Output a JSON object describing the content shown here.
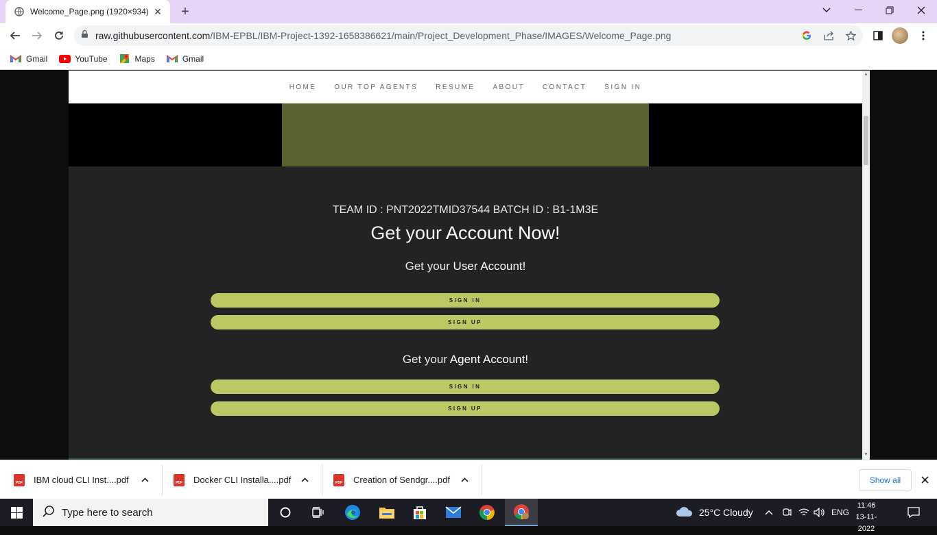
{
  "browser": {
    "tab_title": "Welcome_Page.png (1920×934)",
    "url_domain": "raw.githubusercontent.com",
    "url_path": "/IBM-EPBL/IBM-Project-1392-1658386621/main/Project_Development_Phase/IMAGES/Welcome_Page.png",
    "bookmarks": [
      {
        "label": "Gmail",
        "icon": "gmail-icon"
      },
      {
        "label": "YouTube",
        "icon": "youtube-icon"
      },
      {
        "label": "Maps",
        "icon": "maps-icon"
      },
      {
        "label": "Gmail",
        "icon": "gmail-icon"
      }
    ]
  },
  "site": {
    "nav": [
      "HOME",
      "OUR TOP AGENTS",
      "RESUME",
      "ABOUT",
      "CONTACT",
      "SIGN IN"
    ],
    "team_line": "TEAM ID : PNT2022TMID37544 BATCH ID : B1-1M3E",
    "headline_plain": "Get your ",
    "headline_bold": "Account Now!",
    "user_plain": "Get your ",
    "user_bold": "User Account!",
    "agent_plain": "Get your ",
    "agent_bold": "Agent Account!",
    "user_signin": "SIGN IN",
    "user_signup": "SIGN UP",
    "agent_signin": "SIGN IN",
    "agent_signup": "SIGN UP",
    "colors": {
      "banner": "#5b6131",
      "button": "#bcc863",
      "page_bg": "#232323"
    }
  },
  "downloads": {
    "items": [
      {
        "name": "IBM cloud CLI Inst....pdf"
      },
      {
        "name": "Docker CLI Installa....pdf"
      },
      {
        "name": "Creation of Sendgr....pdf"
      }
    ],
    "pdf_badge": "PDF",
    "show_all": "Show all"
  },
  "taskbar": {
    "search_placeholder": "Type here to search",
    "weather": "25°C  Cloudy",
    "language": "ENG",
    "time": "11:46",
    "date": "13-11-2022"
  }
}
